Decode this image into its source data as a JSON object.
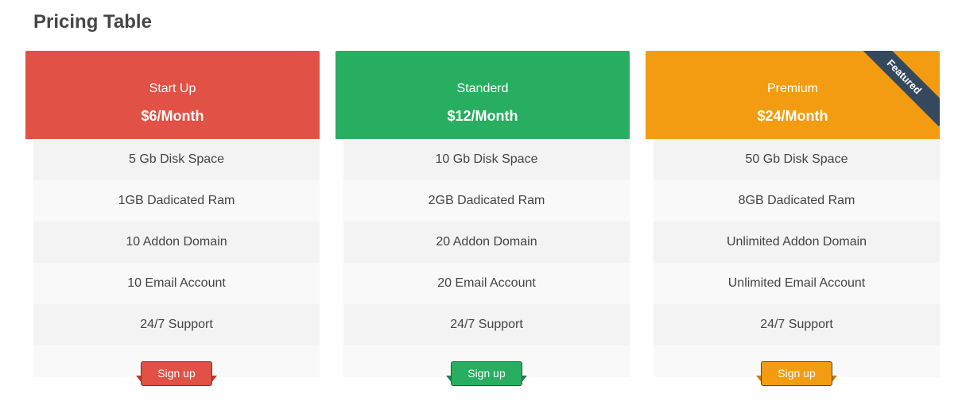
{
  "page_title": "Pricing Table",
  "plans": [
    {
      "name": "Start Up",
      "price": "$6/Month",
      "color": "#e15145",
      "tail_color": "#c0392b",
      "features": [
        "5 Gb Disk Space",
        "1GB Dadicated Ram",
        "10 Addon Domain",
        "10 Email Account",
        "24/7 Support"
      ],
      "button_label": "Sign up"
    },
    {
      "name": "Standerd",
      "price": "$12/Month",
      "color": "#27ae60",
      "tail_color": "#1e8449",
      "features": [
        "10 Gb Disk Space",
        "2GB Dadicated Ram",
        "20 Addon Domain",
        "20 Email Account",
        "24/7 Support"
      ],
      "button_label": "Sign up"
    },
    {
      "name": "Premium",
      "price": "$24/Month",
      "color": "#f39c12",
      "tail_color": "#c87f0a",
      "featured_label": "Featured",
      "features": [
        "50 Gb Disk Space",
        "8GB Dadicated Ram",
        "Unlimited Addon Domain",
        "Unlimited Email Account",
        "24/7 Support"
      ],
      "button_label": "Sign up"
    }
  ]
}
